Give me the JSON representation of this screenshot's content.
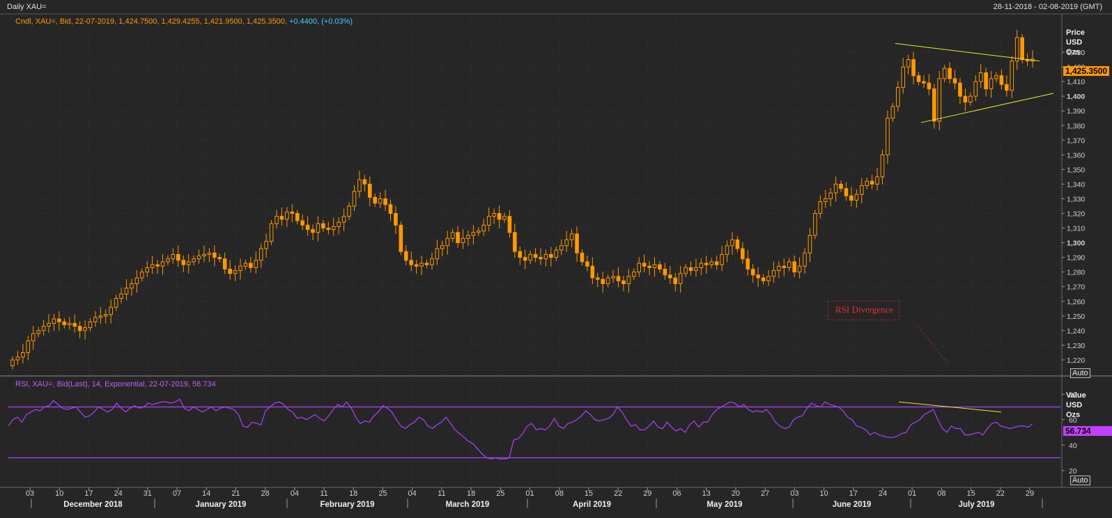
{
  "header": {
    "title": "Daily XAU=",
    "date_range": "28-11-2018 - 02-08-2019 (GMT)"
  },
  "price_panel": {
    "legend_main": "Cndl, XAU=, Bid, 22-07-2019, 1,424.7500, 1,429.4255, 1,421.9500, 1,425.3500,",
    "legend_change": "+0.4400, (+0.03%)",
    "axis_title": [
      "Price",
      "USD",
      "Ozs"
    ],
    "last_price_label": "1,425.3500",
    "auto_label": "Auto",
    "annotation": "RSI Divergence"
  },
  "rsi_panel": {
    "legend": "RSI, XAU=, Bid(Last),  14, Exponential,  22-07-2019, 56.734",
    "axis_title": [
      "Value",
      "USD",
      "Ozs"
    ],
    "last_value_label": "56.734",
    "auto_label": "Auto"
  },
  "colors": {
    "background": "#262626",
    "candle_up": "#ff9900",
    "candle_down": "#ff9900",
    "trendline": "#e8e830",
    "rsi_line": "#b040ff",
    "rsi_band": "#b040ff",
    "last_price_bg": "#ff9900",
    "last_rsi_bg": "#c040ff",
    "legend_price": "#ff9900",
    "legend_change": "#40d0ff",
    "legend_rsi": "#c060ff",
    "annotation": "#e03030"
  },
  "chart_data": [
    {
      "type": "candlestick",
      "title": "Daily XAU=",
      "ylabel": "Price USD Ozs",
      "ylim": [
        1210,
        1440
      ],
      "y_ticks": [
        1220,
        1230,
        1240,
        1250,
        1260,
        1270,
        1280,
        1290,
        1300,
        1310,
        1320,
        1330,
        1340,
        1350,
        1360,
        1370,
        1380,
        1390,
        1400,
        1410,
        1420,
        1430
      ],
      "y_tick_labels": [
        "1,220",
        "1,230",
        "1,240",
        "1,250",
        "1,260",
        "1,270",
        "1,280",
        "1,290",
        "1,300",
        "1,310",
        "1,320",
        "1,330",
        "1,340",
        "1,350",
        "1,360",
        "1,370",
        "1,380",
        "1,390",
        "1,400",
        "1,410",
        "1,420",
        "1,430"
      ],
      "x_ticks": [
        "03",
        "10",
        "17",
        "24",
        "31",
        "07",
        "14",
        "21",
        "28",
        "04",
        "11",
        "18",
        "25",
        "04",
        "11",
        "18",
        "25",
        "01",
        "08",
        "15",
        "22",
        "29",
        "06",
        "13",
        "20",
        "27",
        "03",
        "10",
        "17",
        "24",
        "01",
        "08",
        "15",
        "22",
        "29"
      ],
      "months": [
        "December 2018",
        "January 2019",
        "February 2019",
        "March 2019",
        "April 2019",
        "May 2019",
        "June 2019",
        "July 2019"
      ],
      "series": [
        {
          "name": "XAU=",
          "closes": [
            1220.0,
            1222.0,
            1225.0,
            1233.0,
            1238.0,
            1240.0,
            1243.0,
            1245.0,
            1248.0,
            1246.0,
            1244.0,
            1245.0,
            1243.0,
            1240.0,
            1242.0,
            1246.0,
            1249.0,
            1250.0,
            1251.0,
            1256.0,
            1262.0,
            1265.0,
            1269.0,
            1272.0,
            1276.0,
            1280.0,
            1283.0,
            1285.0,
            1284.0,
            1287.0,
            1289.0,
            1292.0,
            1288.0,
            1285.0,
            1287.0,
            1289.0,
            1291.0,
            1292.0,
            1293.0,
            1290.0,
            1289.0,
            1282.0,
            1279.0,
            1281.0,
            1284.0,
            1286.0,
            1283.0,
            1288.0,
            1296.0,
            1301.0,
            1313.0,
            1318.0,
            1316.0,
            1321.0,
            1320.0,
            1315.0,
            1312.0,
            1309.0,
            1307.0,
            1313.0,
            1310.0,
            1309.0,
            1311.0,
            1314.0,
            1318.0,
            1325.0,
            1335.0,
            1343.0,
            1340.0,
            1331.0,
            1327.0,
            1330.0,
            1326.0,
            1320.0,
            1312.0,
            1294.0,
            1288.0,
            1285.0,
            1284.0,
            1286.0,
            1285.0,
            1289.0,
            1296.0,
            1298.0,
            1303.0,
            1307.0,
            1300.0,
            1303.0,
            1305.0,
            1307.0,
            1308.0,
            1312.0,
            1318.0,
            1320.0,
            1316.0,
            1318.0,
            1307.0,
            1294.0,
            1290.0,
            1288.0,
            1292.0,
            1290.0,
            1289.0,
            1292.0,
            1290.0,
            1295.0,
            1298.0,
            1302.0,
            1306.0,
            1293.0,
            1287.0,
            1284.0,
            1276.0,
            1275.0,
            1272.0,
            1276.0,
            1277.0,
            1274.0,
            1272.0,
            1277.0,
            1280.0,
            1286.0,
            1284.0,
            1283.0,
            1285.0,
            1282.0,
            1278.0,
            1276.0,
            1272.0,
            1279.0,
            1283.0,
            1281.0,
            1283.0,
            1286.0,
            1285.0,
            1287.0,
            1285.0,
            1292.0,
            1298.0,
            1302.0,
            1296.0,
            1289.0,
            1282.0,
            1278.0,
            1276.0,
            1274.0,
            1277.0,
            1281.0,
            1284.0,
            1283.0,
            1287.0,
            1280.0,
            1284.0,
            1293.0,
            1305.0,
            1320.0,
            1328.0,
            1330.0,
            1334.0,
            1340.0,
            1337.0,
            1332.0,
            1329.0,
            1333.0,
            1339.0,
            1342.0,
            1340.0,
            1345.0,
            1360.0,
            1385.0,
            1393.0,
            1406.0,
            1420.0,
            1425.0,
            1414.0,
            1410.0,
            1409.0,
            1405.0,
            1383.0,
            1412.0,
            1419.0,
            1412.0,
            1409.0,
            1400.0,
            1396.0,
            1400.0,
            1410.0,
            1416.0,
            1405.0,
            1412.0,
            1414.0,
            1408.0,
            1404.0,
            1424.0,
            1440.0,
            1425.0,
            1424.0,
            1425.35
          ]
        }
      ]
    },
    {
      "type": "line",
      "title": "RSI, XAU=, Bid(Last), 14, Exponential",
      "ylabel": "Value USD Ozs",
      "ylim": [
        10,
        90
      ],
      "y_ticks": [
        20,
        40,
        60,
        80
      ],
      "bands": [
        70,
        30
      ],
      "last_value": 56.734,
      "series": [
        {
          "name": "RSI",
          "values": [
            55.0,
            60.0,
            62.0,
            58.0,
            64.0,
            66.0,
            68.0,
            67.0,
            70.0,
            71.0,
            75.0,
            72.0,
            69.0,
            68.0,
            69.0,
            70.0,
            66.0,
            62.0,
            63.0,
            66.0,
            70.0,
            68.0,
            66.0,
            68.0,
            73.0,
            69.0,
            66.0,
            69.0,
            71.0,
            69.0,
            70.0,
            73.0,
            72.0,
            73.0,
            74.0,
            74.0,
            73.0,
            74.0,
            76.0,
            69.0,
            67.0,
            70.0,
            68.0,
            66.0,
            68.0,
            70.0,
            67.0,
            69.0,
            70.0,
            69.0,
            68.0,
            64.0,
            55.0,
            54.0,
            58.0,
            57.0,
            56.0,
            67.0,
            70.0,
            73.0,
            74.0,
            72.0,
            68.0,
            66.0,
            61.0,
            62.0,
            60.0,
            62.0,
            64.0,
            61.0,
            59.0,
            63.0,
            68.0,
            72.0,
            70.0,
            74.0,
            69.0,
            62.0,
            57.0,
            59.0,
            58.0,
            63.0,
            66.0,
            71.0,
            69.0,
            66.0,
            60.0,
            55.0,
            53.0,
            56.0,
            58.0,
            62.0,
            60.0,
            55.0,
            53.0,
            56.0,
            58.0,
            62.0,
            57.0,
            52.0,
            49.0,
            46.0,
            43.0,
            41.0,
            37.0,
            33.0,
            30.0,
            29.0,
            30.0,
            29.0,
            29.0,
            30.0,
            44.0,
            45.0,
            49.0,
            55.0,
            57.0,
            52.0,
            53.0,
            52.0,
            55.0,
            61.0,
            55.0,
            53.0,
            57.0,
            58.0,
            60.0,
            63.0,
            67.0,
            64.0,
            60.0,
            59.0,
            60.0,
            61.0,
            64.0,
            70.0,
            66.0,
            60.0,
            55.0,
            56.0,
            52.0,
            52.0,
            55.0,
            59.0,
            54.0,
            53.0,
            58.0,
            54.0,
            51.0,
            53.0,
            50.0,
            56.0,
            59.0,
            54.0,
            58.0,
            58.0,
            64.0,
            68.0,
            70.0,
            72.0,
            74.0,
            73.0,
            70.0,
            72.0,
            68.0,
            66.0,
            67.0,
            66.0,
            68.0,
            64.0,
            58.0,
            55.0,
            53.0,
            54.0,
            60.0,
            62.0,
            63.0,
            69.0,
            73.0,
            71.0,
            70.0,
            74.0,
            72.0,
            71.0,
            70.0,
            67.0,
            62.0,
            60.0,
            55.0,
            54.0,
            52.0,
            48.0,
            50.0,
            48.0,
            47.0,
            46.0,
            46.0,
            47.0,
            49.0,
            50.0,
            56.0,
            58.0,
            60.0,
            64.0,
            66.0,
            68.0,
            60.0,
            53.0,
            50.0,
            55.0,
            53.0,
            53.0,
            48.0,
            48.0,
            49.0,
            50.0,
            48.0,
            53.0,
            57.0,
            58.0,
            55.0,
            54.0,
            53.0,
            54.0,
            55.0,
            55.0,
            54.0,
            56.734
          ]
        }
      ]
    }
  ]
}
